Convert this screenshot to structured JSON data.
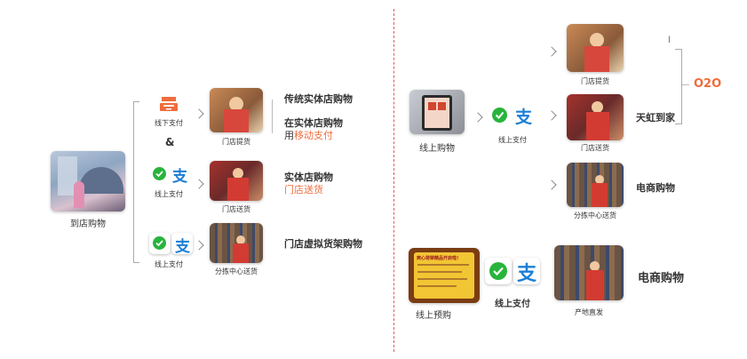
{
  "left": {
    "start_label": "到店购物",
    "amp": "&",
    "rows": [
      {
        "pay_label": "线下支付",
        "photo_label": "门店提货",
        "desc_line1": "传统实体店购物",
        "desc_line2": "在实体店购物",
        "desc_line3_prefix": "用",
        "desc_line3_highlight": "移动支付"
      },
      {
        "pay_label": "线上支付",
        "photo_label": "门店送货",
        "desc_line1": "实体店购物",
        "desc_line2_highlight": "门店送货"
      },
      {
        "pay_label": "线上支付",
        "photo_label": "分拣中心送货",
        "desc_line1": "门店虚拟货架购物"
      }
    ]
  },
  "right": {
    "o2o_label": "O2O",
    "stray_mark": "l",
    "online_label": "线上购物",
    "online_pay_label": "线上支付",
    "options": [
      {
        "photo_label": "门店提货",
        "desc": ""
      },
      {
        "photo_label": "门店送货",
        "desc": "天虹到家"
      },
      {
        "photo_label": "分拣中心送货",
        "desc": "电商购物"
      }
    ],
    "preorder": {
      "label": "线上预购",
      "pay_label": "线上支付",
      "photo_label": "产地直发",
      "desc": "电商购物",
      "poster_title": "爽心荷荣精品开启啦！"
    }
  },
  "colors": {
    "accent": "#ef6c3c",
    "divider": "#e05a5a",
    "wechat": "#28b43c",
    "alipay": "#1a7fd6"
  },
  "icons": [
    "cash-register-icon",
    "wechat-pay-icon",
    "alipay-icon",
    "tablet-shopping-icon"
  ]
}
